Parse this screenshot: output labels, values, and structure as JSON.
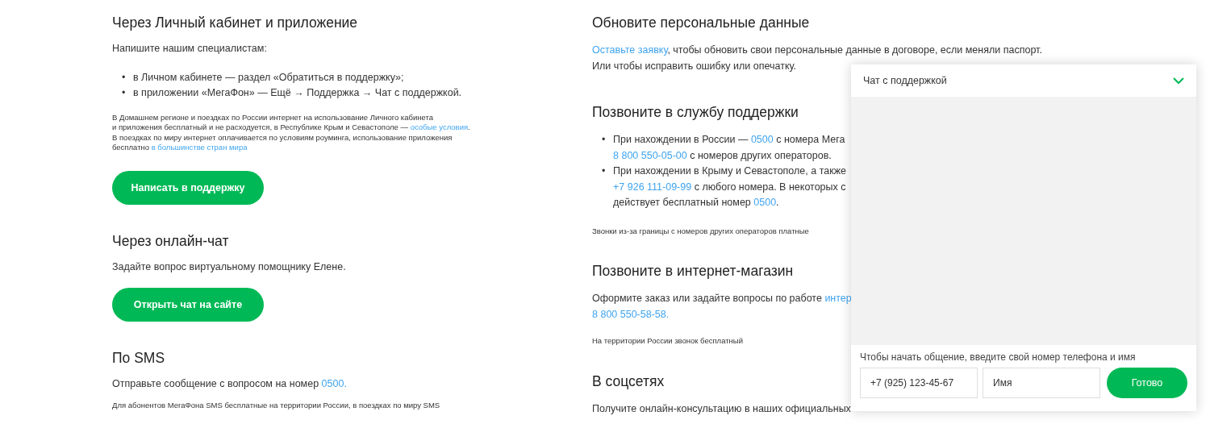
{
  "left_column": [
    {
      "kind": "heading",
      "text": "Через Личный кабинет и приложение"
    },
    {
      "kind": "para",
      "lines": [
        [
          {
            "kind": "text",
            "text": "Напишите нашим специалистам:"
          }
        ]
      ]
    },
    {
      "kind": "bullets",
      "items": [
        {
          "marker": "•",
          "lines": [
            [
              {
                "kind": "text",
                "text": "в Личном кабинете — раздел «Обратиться в поддержку»;"
              }
            ]
          ]
        },
        {
          "marker": "•",
          "lines": [
            [
              {
                "kind": "text",
                "text": "в приложении «МегаФон» — Ещё → Поддержка → Чат с поддержкой."
              }
            ]
          ]
        }
      ]
    },
    {
      "kind": "note",
      "lines": [
        [
          {
            "kind": "text",
            "text": "В Домашнем регионе и поездках по России интернет на использование Личного кабинета"
          }
        ],
        [
          {
            "kind": "text",
            "text": "и приложения бесплатный и не расходуется, в Республике Крым и Севастополе — "
          },
          {
            "kind": "link",
            "text": "особые условия"
          },
          {
            "kind": "text",
            "text": "."
          }
        ],
        [
          {
            "kind": "text",
            "text": "В поездках по миру интернет оплачивается по условиям роуминга, использование приложения"
          }
        ],
        [
          {
            "kind": "text",
            "text": "бесплатно "
          },
          {
            "kind": "link",
            "text": "в большинстве стран мира"
          }
        ]
      ]
    },
    {
      "kind": "button",
      "text": "Написать в поддержку"
    },
    {
      "kind": "heading",
      "text": "Через онлайн-чат"
    },
    {
      "kind": "para",
      "lines": [
        [
          {
            "kind": "text",
            "text": "Задайте вопрос виртуальному помощнику Елене."
          }
        ]
      ]
    },
    {
      "kind": "button",
      "text": "Открыть чат на сайте"
    },
    {
      "kind": "heading",
      "text": "По SMS"
    },
    {
      "kind": "para",
      "lines": [
        [
          {
            "kind": "text",
            "text": "Отправьте сообщение с вопросом на номер "
          },
          {
            "kind": "link",
            "text": "0500."
          }
        ]
      ]
    },
    {
      "kind": "note",
      "lines": [
        [
          {
            "kind": "text",
            "text": "Для абонентов МегаФона SMS бесплатные на территории России, в поездках по миру SMS"
          }
        ]
      ]
    }
  ],
  "right_column": [
    {
      "kind": "heading",
      "text": "Обновите персональные данные"
    },
    {
      "kind": "para",
      "lines": [
        [
          {
            "kind": "link",
            "text": "Оставьте заявку"
          },
          {
            "kind": "text",
            "text": ", чтобы обновить свои персональные данные в договоре, если меняли паспорт."
          }
        ],
        [
          {
            "kind": "text",
            "text": "Или чтобы исправить ошибку или опечатку."
          }
        ]
      ]
    },
    {
      "kind": "heading",
      "text": "Позвоните в службу поддержки"
    },
    {
      "kind": "bullets",
      "items": [
        {
          "marker": "•",
          "lines": [
            [
              {
                "kind": "text",
                "text": "При нахождении в России — "
              },
              {
                "kind": "link",
                "text": "0500"
              },
              {
                "kind": "text",
                "text": " с номера Мега"
              }
            ],
            [
              {
                "kind": "link",
                "text": "8 800 550-05-00"
              },
              {
                "kind": "text",
                "text": " с номеров других операторов."
              }
            ]
          ]
        },
        {
          "marker": "•",
          "lines": [
            [
              {
                "kind": "text",
                "text": "При нахождении в Крыму и Севастополе, а также"
              }
            ],
            [
              {
                "kind": "link",
                "text": "+7 926 111-09-99"
              },
              {
                "kind": "text",
                "text": " с любого номера. В некоторых с"
              }
            ],
            [
              {
                "kind": "text",
                "text": "действует бесплатный номер "
              },
              {
                "kind": "link",
                "text": "0500"
              },
              {
                "kind": "text",
                "text": "."
              }
            ]
          ]
        }
      ]
    },
    {
      "kind": "note",
      "lines": [
        [
          {
            "kind": "text",
            "text": "Звонки из-за границы с номеров других операторов платные"
          }
        ]
      ]
    },
    {
      "kind": "heading",
      "text": "Позвоните в интернет-магазин"
    },
    {
      "kind": "para",
      "lines": [
        [
          {
            "kind": "text",
            "text": "Оформите заказ или задайте вопросы по работе "
          },
          {
            "kind": "link",
            "text": "интер"
          }
        ],
        [
          {
            "kind": "link",
            "text": "8 800 550-58-58."
          }
        ]
      ]
    },
    {
      "kind": "note",
      "lines": [
        [
          {
            "kind": "text",
            "text": "На территории России звонок бесплатный"
          }
        ]
      ]
    },
    {
      "kind": "heading",
      "text": "В соцсетях"
    },
    {
      "kind": "para",
      "lines": [
        [
          {
            "kind": "text",
            "text": "Получите онлайн-консультацию в наших официальных"
          }
        ]
      ]
    }
  ],
  "chat_widget": {
    "title": "Чат с поддержкой",
    "expanded": true,
    "hint": "Чтобы начать общение, введите свой номер телефона и имя",
    "phone_field": {
      "placeholder": "+7 (925) 123-45-67"
    },
    "name_field": {
      "placeholder": "Имя"
    },
    "submit_button": "Готово"
  }
}
